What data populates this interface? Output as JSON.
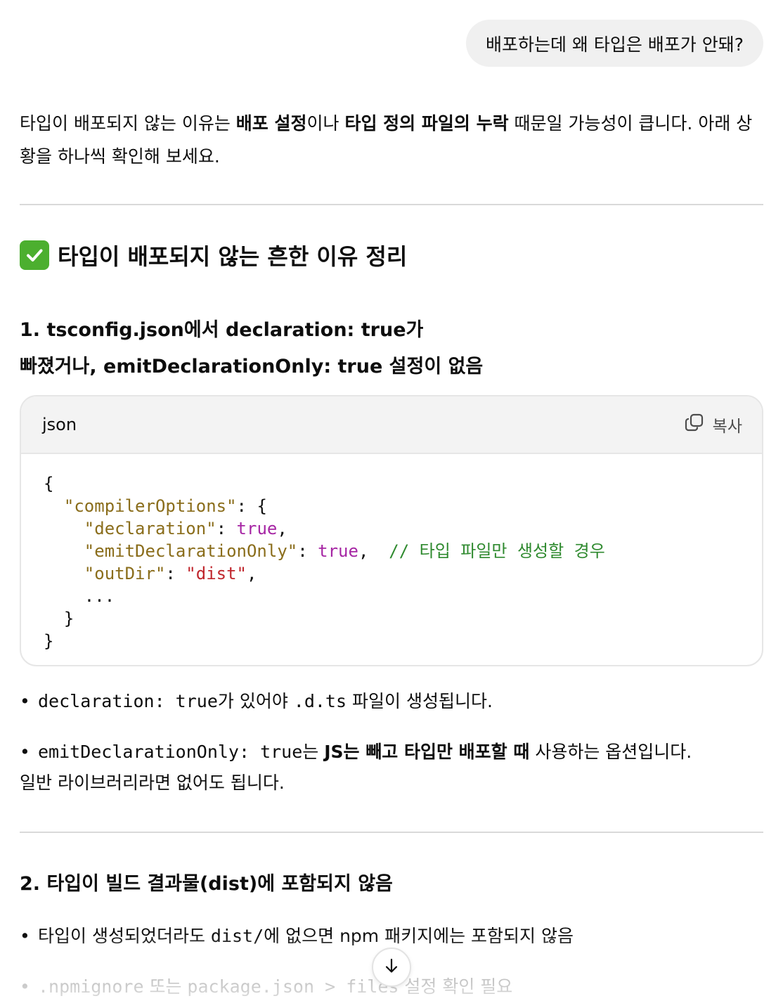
{
  "user_message": "배포하는데 왜 타입은 배포가 안돼?",
  "intro": {
    "t1": "타입이 배포되지 않는 이유는 ",
    "b1": "배포 설정",
    "t2": "이나 ",
    "b2": "타입 정의 파일의 누락",
    "t3": " 때문일 가능성이 큽니다. 아래 상황을 하나씩 확인해 보세요."
  },
  "section_title": "타입이 배포되지 않는 흔한 이유 정리",
  "item1": {
    "title_line1": "1. tsconfig.json에서 declaration: true가",
    "title_line2": "빠졌거나, emitDeclarationOnly: true 설정이 없음"
  },
  "code": {
    "language": "json",
    "copy_label": "복사",
    "l1": "{",
    "l2_indent": "  ",
    "l2_key": "\"compilerOptions\"",
    "l2_rest": ": {",
    "l3_indent": "    ",
    "l3_key": "\"declaration\"",
    "l3_colon": ": ",
    "l3_val": "true",
    "l3_end": ",",
    "l4_indent": "    ",
    "l4_key": "\"emitDeclarationOnly\"",
    "l4_colon": ": ",
    "l4_val": "true",
    "l4_end": ",  ",
    "l4_comment": "// 타입 파일만 생성할 경우",
    "l5_indent": "    ",
    "l5_key": "\"outDir\"",
    "l5_colon": ": ",
    "l5_val": "\"dist\"",
    "l5_end": ",",
    "l6": "    ...",
    "l7": "  }",
    "l8": "}"
  },
  "bullets1": {
    "b1_code1": "declaration: true",
    "b1_t1": "가 있어야 ",
    "b1_code2": ".d.ts",
    "b1_t2": " 파일이 생성됩니다.",
    "b2_code1": "emitDeclarationOnly: true",
    "b2_t1": "는 ",
    "b2_bold": "JS는 빼고 타입만 배포할 때",
    "b2_t2": " 사용하는 옵션입니다.",
    "b2_line2": "일반 라이브러리라면 없어도 됩니다."
  },
  "item2": {
    "title": "2. 타입이 빌드 결과물(dist)에 포함되지 않음"
  },
  "bullets2": {
    "b1_t1": "타입이 생성되었더라도 ",
    "b1_code": "dist/",
    "b1_t2": "에 없으면 npm 패키지에는 포함되지 않음",
    "b2_code1": ".npmignore",
    "b2_t1": " 또는 ",
    "b2_code2": "package.json > files",
    "b2_t2": " 설정 확인 필요"
  }
}
